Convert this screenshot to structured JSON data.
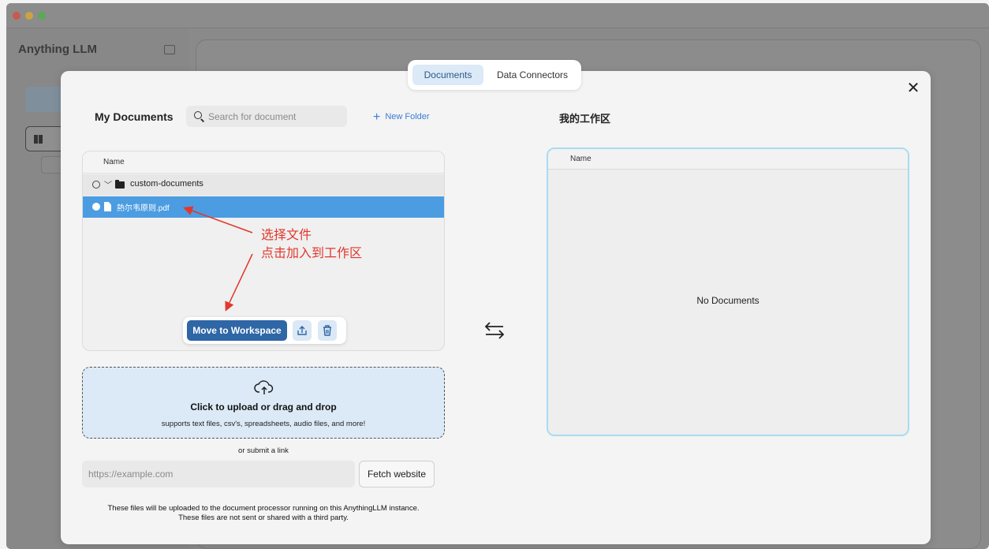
{
  "background_app": {
    "brand": "Anything LLM"
  },
  "modal": {
    "tabs": [
      {
        "label": "Documents",
        "active": true
      },
      {
        "label": "Data Connectors",
        "active": false
      }
    ],
    "left": {
      "title": "My Documents",
      "search_placeholder": "Search for document",
      "new_folder_label": "New Folder",
      "column_name": "Name",
      "folder": {
        "name": "custom-documents"
      },
      "file": {
        "name": "熱尔韦原则.pdf",
        "selected": true
      },
      "annotation_line1": "选择文件",
      "annotation_line2": "点击加入到工作区",
      "move_button_label": "Move to Workspace",
      "upload": {
        "title": "Click to upload or drag and drop",
        "subtitle": "supports text files, csv's, spreadsheets, audio files, and more!"
      },
      "or_submit_link": "or submit a link",
      "url_placeholder": "https://example.com",
      "fetch_button_label": "Fetch website",
      "note_line1": "These files will be uploaded to the document processor running on this AnythingLLM instance.",
      "note_line2": "These files are not sent or shared with a third party."
    },
    "right": {
      "title": "我的工作区",
      "column_name": "Name",
      "empty_text": "No Documents"
    }
  },
  "colors": {
    "accent": "#2e66a6",
    "selection": "#4b9ce1",
    "annotation": "#e2372b",
    "workspace_border": "#a8dcee"
  }
}
